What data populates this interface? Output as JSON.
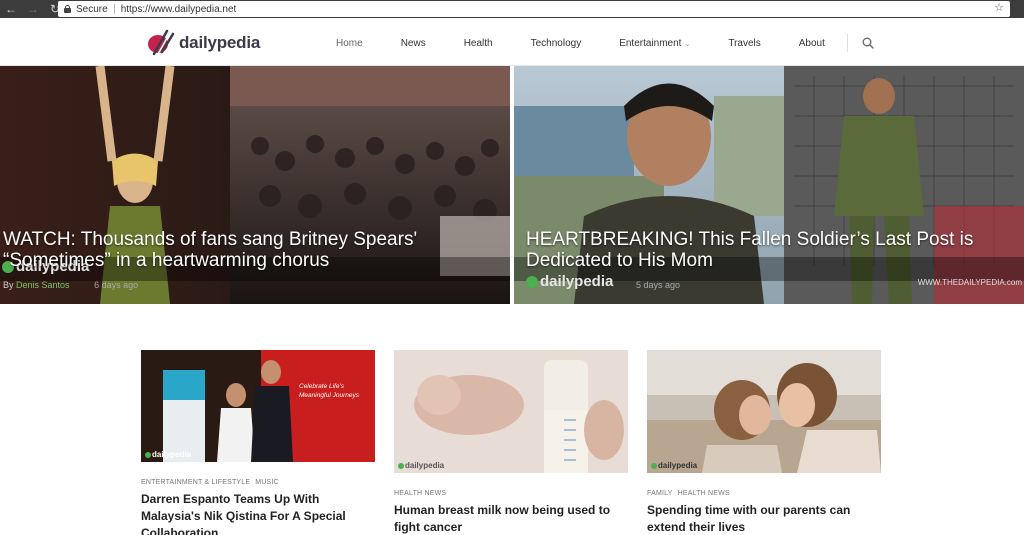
{
  "browser": {
    "secure_label": "Secure",
    "url": "https://www.dailypedia.net"
  },
  "site": {
    "logo_text": "dailypedia",
    "brand_colors": {
      "primary": "#c4224a",
      "dark": "#3a3a4a",
      "accent_green": "#7bc36a"
    }
  },
  "nav": {
    "items": [
      {
        "label": "Home",
        "active": true
      },
      {
        "label": "News"
      },
      {
        "label": "Health"
      },
      {
        "label": "Technology"
      },
      {
        "label": "Entertainment",
        "has_dropdown": true
      },
      {
        "label": "Travels"
      },
      {
        "label": "About"
      }
    ]
  },
  "hero": [
    {
      "title": "WATCH: Thousands of fans sang Britney Spears' “Sometimes” in a heartwarming chorus",
      "author_prefix": "By",
      "author": "Denis Santos",
      "date": "6 days ago",
      "watermark": "dailypedia"
    },
    {
      "title": "HEARTBREAKING! This Fallen Soldier’s Last Post is Dedicated to His Mom",
      "date": "5 days ago",
      "watermark": "dailypedia",
      "site_watermark": "WWW.THEDAILYPEDIA.com"
    }
  ],
  "cards": [
    {
      "categories": [
        "ENTERTAINMENT & LIFESTYLE",
        "MUSIC"
      ],
      "title": "Darren Espanto Teams Up With Malaysia's Nik Qistina For A Special Collaboration",
      "banner_text": "Celebrate Life's Meaningful Journeys",
      "mini_logo": "dailypedia"
    },
    {
      "categories": [
        "HEALTH NEWS"
      ],
      "title": "Human breast milk now being used to fight cancer",
      "mini_logo": "dailypedia"
    },
    {
      "categories": [
        "FAMILY",
        "HEALTH NEWS"
      ],
      "title": "Spending time with our parents can extend their lives",
      "mini_logo": "dailypedia"
    }
  ]
}
